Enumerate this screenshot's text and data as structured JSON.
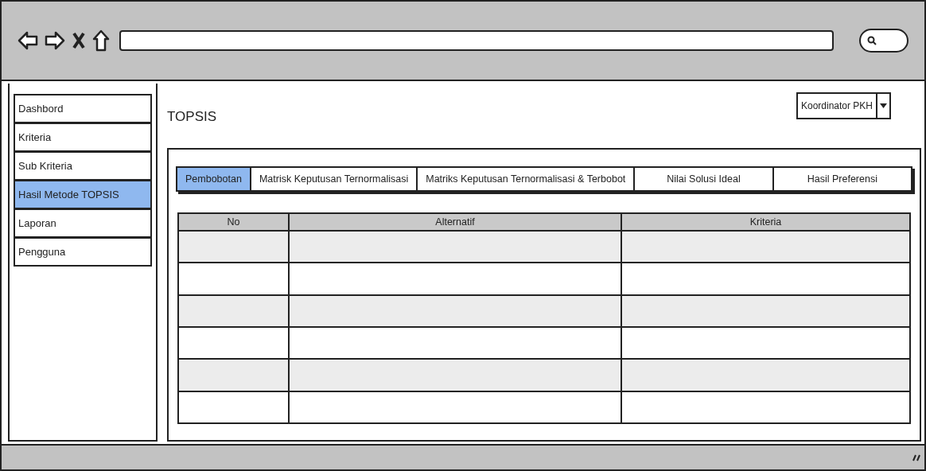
{
  "sidebar": {
    "items": [
      {
        "label": "Dashbord",
        "selected": false
      },
      {
        "label": "Kriteria",
        "selected": false
      },
      {
        "label": "Sub Kriteria",
        "selected": false
      },
      {
        "label": "Hasil Metode TOPSIS",
        "selected": true
      },
      {
        "label": "Laporan",
        "selected": false
      },
      {
        "label": "Pengguna",
        "selected": false
      }
    ]
  },
  "page_title": "TOPSIS",
  "role_dropdown": {
    "value": "Koordinator PKH"
  },
  "tabs": [
    {
      "label": "Pembobotan",
      "selected": true
    },
    {
      "label": "Matrisk Keputusan Ternormalisasi",
      "selected": false
    },
    {
      "label": "Matriks Keputusan Ternormalisasi & Terbobot",
      "selected": false
    },
    {
      "label": "Nilai Solusi Ideal",
      "selected": false
    },
    {
      "label": "Hasil Preferensi",
      "selected": false
    }
  ],
  "table": {
    "columns": [
      "No",
      "Alternatif",
      "Kriteria"
    ]
  }
}
